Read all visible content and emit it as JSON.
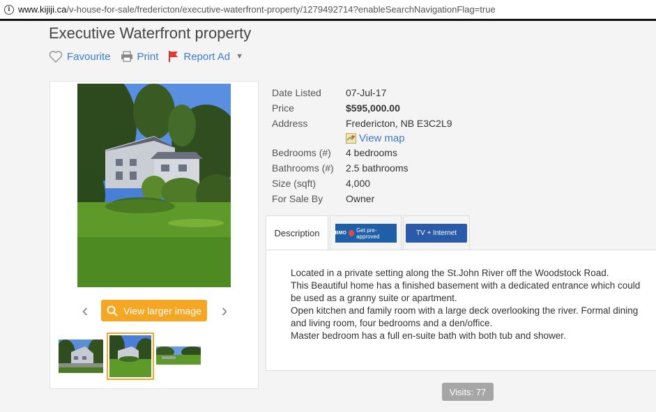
{
  "browser": {
    "url_host": "www.kijiji.ca",
    "url_path": "/v-house-for-sale/fredericton/executive-waterfront-property/1279492714?enableSearchNavigationFlag=true"
  },
  "listing": {
    "title": "Executive Waterfront property",
    "actions": {
      "favourite": "Favourite",
      "print": "Print",
      "report": "Report Ad"
    }
  },
  "gallery": {
    "view_larger": "View larger image",
    "prev_icon": "chevron-left-icon",
    "next_icon": "chevron-right-icon"
  },
  "details": {
    "date_listed_label": "Date Listed",
    "date_listed": "07-Jul-17",
    "price_label": "Price",
    "price": "$595,000.00",
    "address_label": "Address",
    "address": "Fredericton, NB E3C2L9",
    "view_map": "View map",
    "bedrooms_label": "Bedrooms (#)",
    "bedrooms": "4 bedrooms",
    "bathrooms_label": "Bathrooms (#)",
    "bathrooms": "2.5 bathrooms",
    "size_label": "Size (sqft)",
    "size": "4,000",
    "for_sale_by_label": "For Sale By",
    "for_sale_by": "Owner"
  },
  "tabs": {
    "description": "Description",
    "bmo_brand": "BMO",
    "bmo_text": "Get pre-approved",
    "tv_internet": "TV + Internet"
  },
  "description": {
    "lines": [
      "Located in a private setting along the St.John River off the Woodstock Road.",
      "This Beautiful home has a finished basement with a dedicated entrance which could be used as a granny suite or apartment.",
      "Open kitchen and family room with a large deck overlooking the river. Formal dining and living room, four bedrooms and a den/office.",
      "Master bedroom has a full en-suite bath with both tub and shower."
    ]
  },
  "visits": "Visits: 77",
  "colors": {
    "link": "#3f7ad0",
    "button": "#f5a623",
    "visits_bg": "#a6a6a6"
  }
}
